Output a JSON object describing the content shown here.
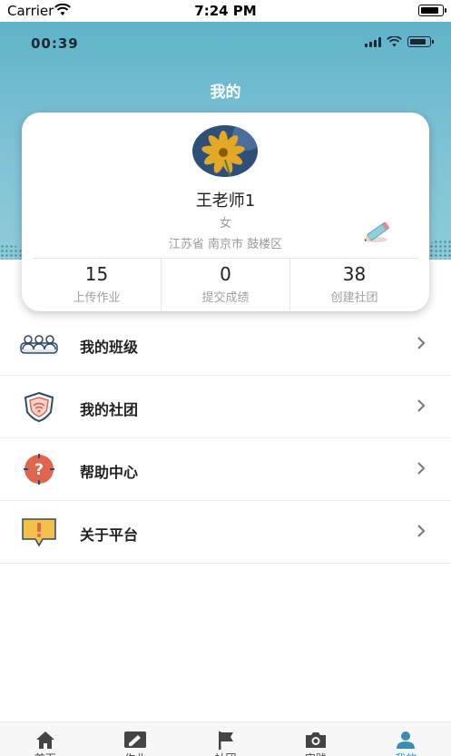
{
  "status_bar": {
    "carrier": "Carrier",
    "time": "7:24 PM"
  },
  "inner_status_bar": {
    "time": "00:39"
  },
  "header": {
    "title": "我的"
  },
  "profile": {
    "name": "王老师1",
    "gender": "女",
    "location": "江苏省 南京市 鼓楼区"
  },
  "stats": [
    {
      "value": "15",
      "label": "上传作业"
    },
    {
      "value": "0",
      "label": "提交成绩"
    },
    {
      "value": "38",
      "label": "创建社团"
    }
  ],
  "menu": [
    {
      "label": "我的班级",
      "icon": "class-group-icon"
    },
    {
      "label": "我的社团",
      "icon": "club-shield-icon"
    },
    {
      "label": "帮助中心",
      "icon": "help-question-icon"
    },
    {
      "label": "关于平台",
      "icon": "about-alert-icon"
    }
  ],
  "tabbar": [
    {
      "label": "首页",
      "icon": "home-icon"
    },
    {
      "label": "作业",
      "icon": "homework-icon"
    },
    {
      "label": "社团",
      "icon": "flag-icon"
    },
    {
      "label": "实践",
      "icon": "camera-icon"
    },
    {
      "label": "我的",
      "icon": "user-icon",
      "active": true
    }
  ],
  "colors": {
    "header": "#6bbccf",
    "accent": "#3a8fb0",
    "tab_active": "#3a8fb0"
  }
}
